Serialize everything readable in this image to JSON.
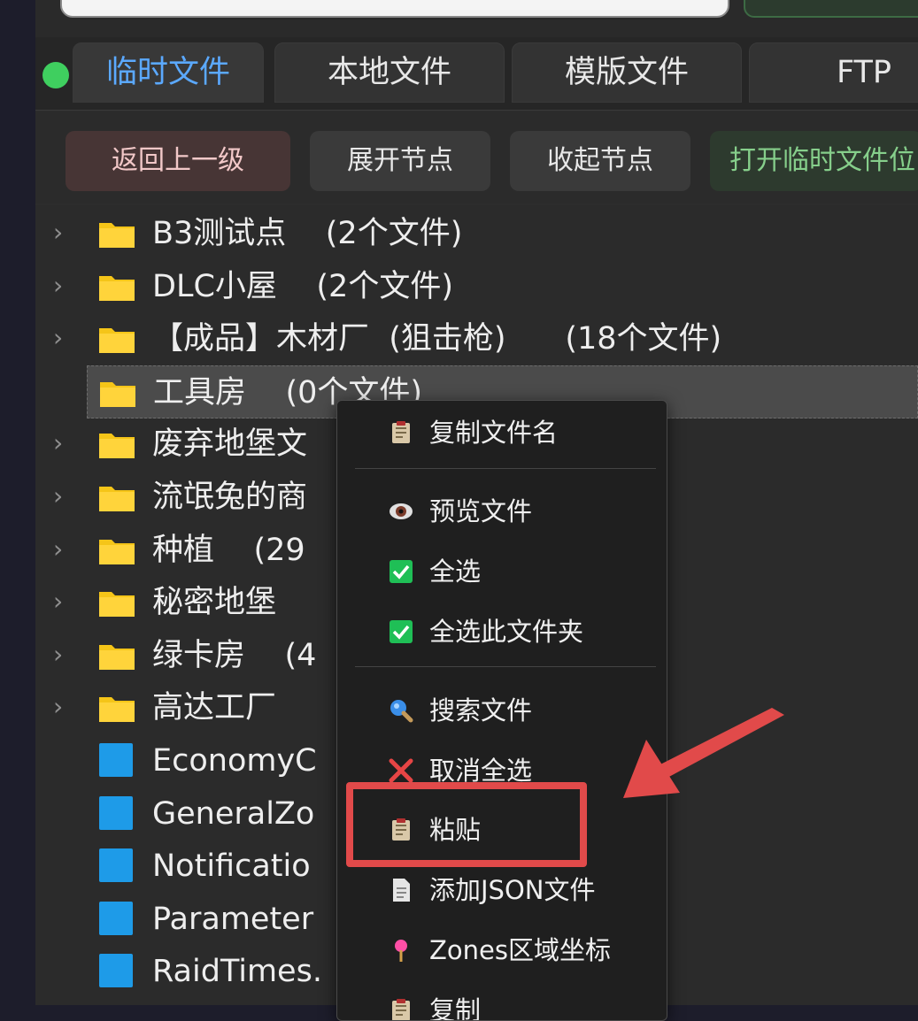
{
  "tabs": [
    {
      "label": "临时文件",
      "active": true
    },
    {
      "label": "本地文件",
      "active": false
    },
    {
      "label": "模版文件",
      "active": false
    },
    {
      "label": "FTP",
      "active": false
    }
  ],
  "toolbar": {
    "back": "返回上一级",
    "expand": "展开节点",
    "collapse": "收起节点",
    "open_temp": "打开临时文件位"
  },
  "tree": [
    {
      "label": "B3测试点    (2个文件)",
      "type": "folder",
      "expandable": true
    },
    {
      "label": "DLC小屋    (2个文件)",
      "type": "folder",
      "expandable": true
    },
    {
      "label": "【成品】木材厂  (狙击枪)      (18个文件)",
      "type": "folder",
      "expandable": true
    },
    {
      "label": "工具房    (0个文件)",
      "type": "folder",
      "expandable": false,
      "selected": true
    },
    {
      "label": "废弃地堡文",
      "type": "folder",
      "expandable": true
    },
    {
      "label": "流氓兔的商",
      "type": "folder",
      "expandable": true
    },
    {
      "label": "种植    (29",
      "type": "folder",
      "expandable": true
    },
    {
      "label": "秘密地堡",
      "type": "folder",
      "expandable": true
    },
    {
      "label": "绿卡房    (4",
      "type": "folder",
      "expandable": true
    },
    {
      "label": "高达工厂",
      "type": "folder",
      "expandable": true
    },
    {
      "label": "EconomyC",
      "type": "file",
      "expandable": false
    },
    {
      "label": "GeneralZo",
      "type": "file",
      "expandable": false
    },
    {
      "label": "Notificatio",
      "type": "file",
      "expandable": false
    },
    {
      "label": "Parameter",
      "type": "file",
      "expandable": false
    },
    {
      "label": "RaidTimes.",
      "type": "file",
      "expandable": false
    }
  ],
  "context_menu": [
    {
      "label": "复制文件名",
      "icon": "clipboard-icon"
    },
    {
      "label": "预览文件",
      "icon": "eye-icon"
    },
    {
      "label": "全选",
      "icon": "checkbox-checked-icon"
    },
    {
      "label": "全选此文件夹",
      "icon": "checkbox-checked-icon"
    },
    {
      "label": "搜索文件",
      "icon": "magnifier-icon"
    },
    {
      "label": "取消全选",
      "icon": "close-x-icon"
    },
    {
      "label": "粘贴",
      "icon": "clipboard-icon"
    },
    {
      "label": "添加JSON文件",
      "icon": "document-icon"
    },
    {
      "label": "Zones区域坐标",
      "icon": "map-pin-icon"
    },
    {
      "label": "复制",
      "icon": "clipboard-icon"
    }
  ],
  "colors": {
    "accent": "#5ba9ff",
    "status_dot": "#3fcf5f",
    "folder": "#f5c518",
    "file": "#1e9be8",
    "highlight": "#e14a4a"
  }
}
